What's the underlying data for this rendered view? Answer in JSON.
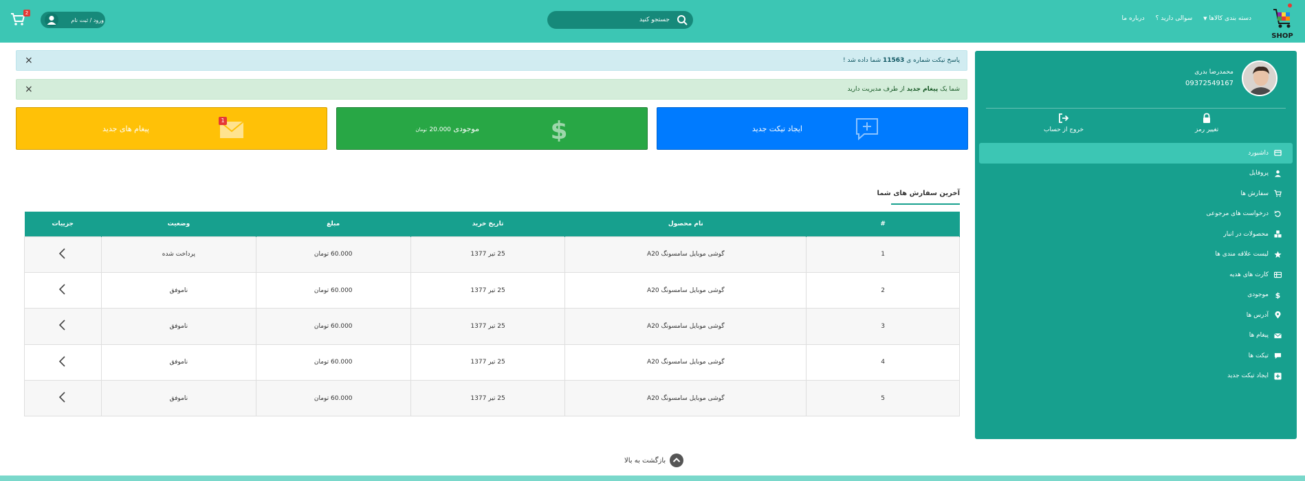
{
  "header": {
    "logo_text": "SHOP",
    "nav": [
      {
        "label": "دسته بندی کالاها",
        "has_caret": true
      },
      {
        "label": "سوالی دارید ؟",
        "has_caret": false
      },
      {
        "label": "درباره ما",
        "has_caret": false
      }
    ],
    "search_placeholder": "جستجو کنید",
    "login_label": "ورود / ثبت نام",
    "cart_count": "2"
  },
  "sidebar": {
    "user_name": "محمدرضا بدری",
    "user_phone": "09372549167",
    "change_password_label": "تغییر رمز",
    "logout_label": "خروج از حساب",
    "menu": [
      {
        "label": "داشبورد",
        "icon": "dashboard-icon",
        "active": true
      },
      {
        "label": "پروفایل",
        "icon": "user-icon",
        "active": false
      },
      {
        "label": "سفارش ها",
        "icon": "cart-icon",
        "active": false
      },
      {
        "label": "درخواست های مرجوعی",
        "icon": "return-icon",
        "active": false
      },
      {
        "label": "محصولات در انبار",
        "icon": "boxes-icon",
        "active": false
      },
      {
        "label": "لیست علاقه مندی ها",
        "icon": "star-icon",
        "active": false
      },
      {
        "label": "کارت های هدیه",
        "icon": "gift-card-icon",
        "active": false
      },
      {
        "label": "موجودی",
        "icon": "dollar-icon",
        "active": false
      },
      {
        "label": "آدرس ها",
        "icon": "location-icon",
        "active": false
      },
      {
        "label": "پیغام ها",
        "icon": "envelope-icon",
        "active": false
      },
      {
        "label": "تیکت ها",
        "icon": "chat-icon",
        "active": false
      },
      {
        "label": "ایجاد تیکت جدید",
        "icon": "plus-square-icon",
        "active": false
      }
    ]
  },
  "alerts": {
    "ticket_prefix": "پاسخ تیکت شماره ی",
    "ticket_number": "11563",
    "ticket_suffix": "شما داده شد !",
    "message_prefix": "شما یک",
    "message_bold": "پیغام جدید",
    "message_suffix": "از طرف مدیریت دارید",
    "close_glyph": "×"
  },
  "cards": {
    "new_ticket": "ایجاد تیکت جدید",
    "balance_label": "موجودی",
    "balance_amount": "20.000",
    "balance_unit": "تومان",
    "messages_label": "پیغام های جدید",
    "messages_badge": "1"
  },
  "orders": {
    "title": "آخرین سفارش های شما",
    "columns": [
      "#",
      "نام محصول",
      "تاریخ خرید",
      "مبلغ",
      "وضعیت",
      "جزییات"
    ],
    "rows": [
      {
        "num": "1",
        "product": "گوشی موبایل سامسونگ A20",
        "date": "25 تیر 1377",
        "price": "60.000 تومان",
        "status": "پرداخت شده",
        "status_type": "paid"
      },
      {
        "num": "2",
        "product": "گوشی موبایل سامسونگ A20",
        "date": "25 تیر 1377",
        "price": "60.000 تومان",
        "status": "ناموفق",
        "status_type": "failed"
      },
      {
        "num": "3",
        "product": "گوشی موبایل سامسونگ A20",
        "date": "25 تیر 1377",
        "price": "60.000 تومان",
        "status": "ناموفق",
        "status_type": "failed"
      },
      {
        "num": "4",
        "product": "گوشی موبایل سامسونگ A20",
        "date": "25 تیر 1377",
        "price": "60.000 تومان",
        "status": "ناموفق",
        "status_type": "failed"
      },
      {
        "num": "5",
        "product": "گوشی موبایل سامسونگ A20",
        "date": "25 تیر 1377",
        "price": "60.000 تومان",
        "status": "ناموفق",
        "status_type": "failed"
      }
    ]
  },
  "back_to_top": "بازگشت به بالا",
  "colors": {
    "primary": "#3cc6b4",
    "primary_dark": "#17a08e",
    "blue": "#007bff",
    "green": "#28a745",
    "yellow": "#ffc107",
    "danger": "#e53935"
  }
}
